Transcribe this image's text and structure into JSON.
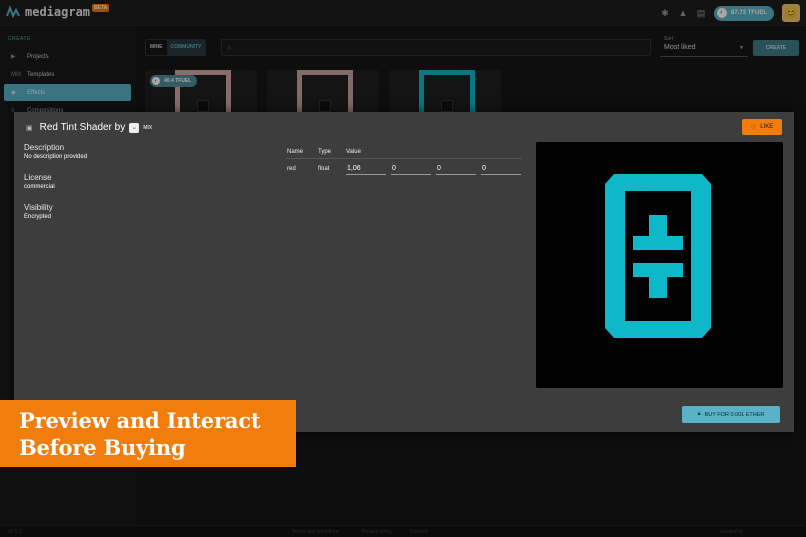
{
  "app": {
    "name": "mediagram",
    "beta_badge": "BETA",
    "balance": "87.73 TFUEL"
  },
  "sidebar": {
    "section_create": "CREATE",
    "items": [
      {
        "label": "Projects",
        "icon": "video-icon"
      },
      {
        "label": "Templates",
        "icon": "mix-icon",
        "icon_text": "MIX"
      },
      {
        "label": "Effects",
        "icon": "effects-icon"
      },
      {
        "label": "Compositions",
        "icon": "layers-icon"
      }
    ]
  },
  "toolbar": {
    "tab_mine": "MINE",
    "tab_community": "COMMUNITY",
    "search_placeholder": "",
    "sort_label": "Sort",
    "sort_value": "Most liked",
    "create_label": "CREATE"
  },
  "cards": [
    {
      "price": "40.4 TFUEL",
      "color": "#d6a7a7"
    },
    {
      "price": "",
      "color": "#c9a2a2"
    },
    {
      "price": "",
      "color": "#0eb8c8"
    }
  ],
  "modal": {
    "title_prefix": "Red Tint Shader by",
    "owner": "MIX",
    "like_label": "LIKE",
    "description_label": "Description",
    "description_value": "No description provided",
    "license_label": "License",
    "license_value": "commercial",
    "visibility_label": "Visibility",
    "visibility_value": "Encrypted",
    "params": {
      "headers": {
        "name": "Name",
        "type": "Type",
        "value": "Value"
      },
      "rows": [
        {
          "name": "red",
          "type": "float",
          "values": [
            "1,06",
            "0",
            "0",
            "0"
          ]
        }
      ]
    },
    "buy_label": "BUY FOR 0.001 ETHER",
    "accent_color": "#0eb8c8"
  },
  "footer": {
    "version": "v0.5.1",
    "link1": "Terms and conditions",
    "link2": "Privacy policy",
    "link3": "Contact",
    "credit": "created by"
  },
  "banner": {
    "line1": "Preview and Interact",
    "line2": "Before Buying"
  },
  "colors": {
    "accent": "#5ab2c6",
    "orange": "#f07d0c"
  }
}
